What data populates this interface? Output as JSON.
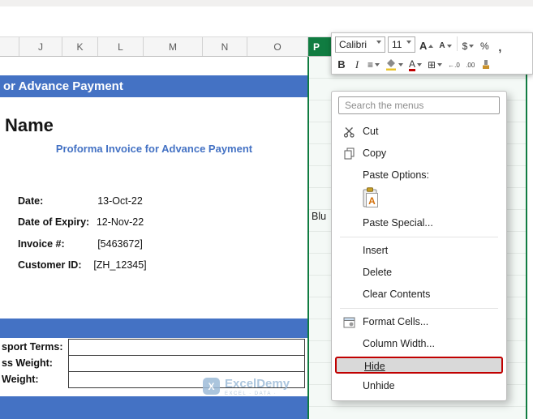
{
  "sheet": {
    "columns": [
      "J",
      "K",
      "L",
      "M",
      "N",
      "O",
      "P"
    ],
    "selected_column": "P",
    "partial_cell_text": "Blu"
  },
  "invoice": {
    "banner_title": "or Advance Payment",
    "company_name": "Name",
    "subtitle": "Proforma Invoice for Advance Payment",
    "fields": [
      {
        "label": "Date:",
        "value": "13-Oct-22"
      },
      {
        "label": "Date of Expiry:",
        "value": "12-Nov-22"
      },
      {
        "label": "Invoice #:",
        "value": "[5463672]"
      },
      {
        "label": "Customer ID:",
        "value": "[ZH_12345]"
      }
    ],
    "shipping_rows": [
      {
        "label": "sport Terms:",
        "value": ""
      },
      {
        "label": "ss Weight:",
        "value": ""
      },
      {
        "label": "Weight:",
        "value": ""
      }
    ],
    "watermark": {
      "brand": "ExcelDemy",
      "tagline": "EXCEL · DATA ·"
    }
  },
  "mini_toolbar": {
    "font_name": "Calibri",
    "font_size": "11",
    "grow_font_label": "A",
    "shrink_font_label": "A",
    "accounting_label": "$",
    "percent_label": "%",
    "comma_label": ",",
    "bold_label": "B",
    "italic_label": "I",
    "align_label": "≡",
    "borders_label": "⊞",
    "font_color_label": "A",
    "increase_decimal_label": "←.0",
    "decrease_decimal_label": ".00"
  },
  "context_menu": {
    "search_placeholder": "Search the menus",
    "items": [
      {
        "label": "Cut"
      },
      {
        "label": "Copy"
      },
      {
        "label": "Paste Options:"
      },
      {
        "label": "Paste Special..."
      },
      {
        "label": "Insert"
      },
      {
        "label": "Delete"
      },
      {
        "label": "Clear Contents"
      },
      {
        "label": "Format Cells..."
      },
      {
        "label": "Column Width..."
      },
      {
        "label": "Hide",
        "highlighted": true
      },
      {
        "label": "Unhide"
      }
    ]
  },
  "colors": {
    "accent_blue": "#4472C4",
    "selection_green": "#107C41",
    "selection_tint": "#F4F9F6",
    "highlight_red": "#C00000",
    "watermark_blue": "#9DBBD8"
  }
}
